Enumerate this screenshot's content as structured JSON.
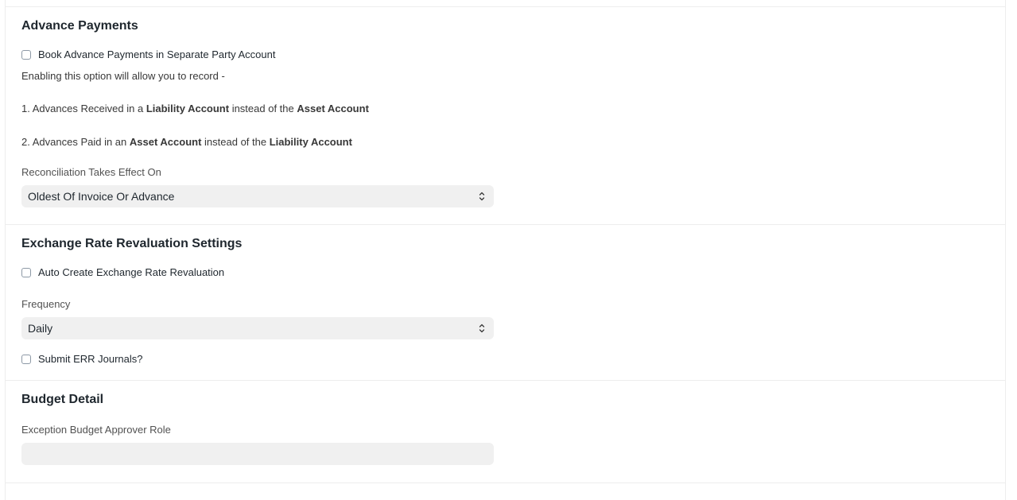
{
  "advance_payments": {
    "title": "Advance Payments",
    "book_separate_label": "Book Advance Payments in Separate Party Account",
    "book_separate_checked": false,
    "description_intro": "Enabling this option will allow you to record -",
    "point1": {
      "prefix": "1. Advances Received in a ",
      "bold1": "Liability Account",
      "middle": " instead of the ",
      "bold2": "Asset Account"
    },
    "point2": {
      "prefix": "2. Advances Paid in an ",
      "bold1": "Asset Account",
      "middle": " instead of the ",
      "bold2": "Liability Account"
    },
    "reconciliation_label": "Reconciliation Takes Effect On",
    "reconciliation_value": "Oldest Of Invoice Or Advance"
  },
  "exchange_rate": {
    "title": "Exchange Rate Revaluation Settings",
    "auto_create_label": "Auto Create Exchange Rate Revaluation",
    "auto_create_checked": false,
    "frequency_label": "Frequency",
    "frequency_value": "Daily",
    "submit_err_label": "Submit ERR Journals?",
    "submit_err_checked": false
  },
  "budget_detail": {
    "title": "Budget Detail",
    "approver_role_label": "Exception Budget Approver Role",
    "approver_role_value": ""
  },
  "icons": {
    "select": "chevron-up-down-icon"
  },
  "colors": {
    "border": "#ededed",
    "control_bg": "#f0f0f0",
    "heading": "#1f272e",
    "text": "#383838"
  }
}
